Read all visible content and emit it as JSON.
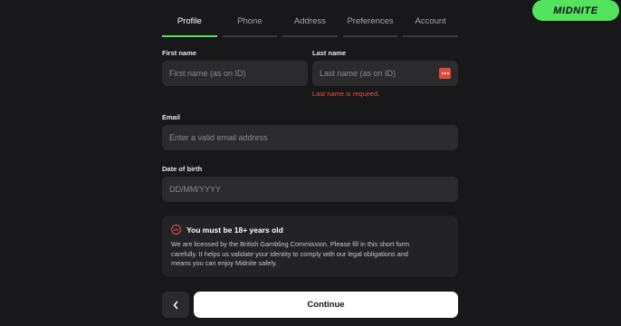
{
  "tabs": [
    {
      "label": "Profile",
      "active": true
    },
    {
      "label": "Phone",
      "active": false
    },
    {
      "label": "Address",
      "active": false
    },
    {
      "label": "Preferences",
      "active": false
    },
    {
      "label": "Account",
      "active": false
    }
  ],
  "brand": {
    "logo_text": "MIDNITE",
    "accent_color": "#53e35f"
  },
  "form": {
    "first_name": {
      "label": "First name",
      "placeholder": "First name (as on ID)",
      "value": ""
    },
    "last_name": {
      "label": "Last name",
      "placeholder": "Last name (as on ID)",
      "value": "",
      "error": "Last name is required."
    },
    "email": {
      "label": "Email",
      "placeholder": "Enter a valid email address",
      "value": ""
    },
    "dob": {
      "label": "Date of birth",
      "placeholder": "DD/MM/YYYY",
      "value": ""
    }
  },
  "notice": {
    "icon_text": "18+",
    "title": "You must be 18+ years old",
    "body": "We are licensed by the British Gambling Commission. Please fill in this short form\ncarefully. It helps us validate your identity to comply with our legal obligations and\nmeans you can enjoy Midnite safely."
  },
  "actions": {
    "continue_label": "Continue"
  },
  "colors": {
    "error": "#e5553f",
    "background": "#18181a",
    "field": "#2b2b2e"
  }
}
